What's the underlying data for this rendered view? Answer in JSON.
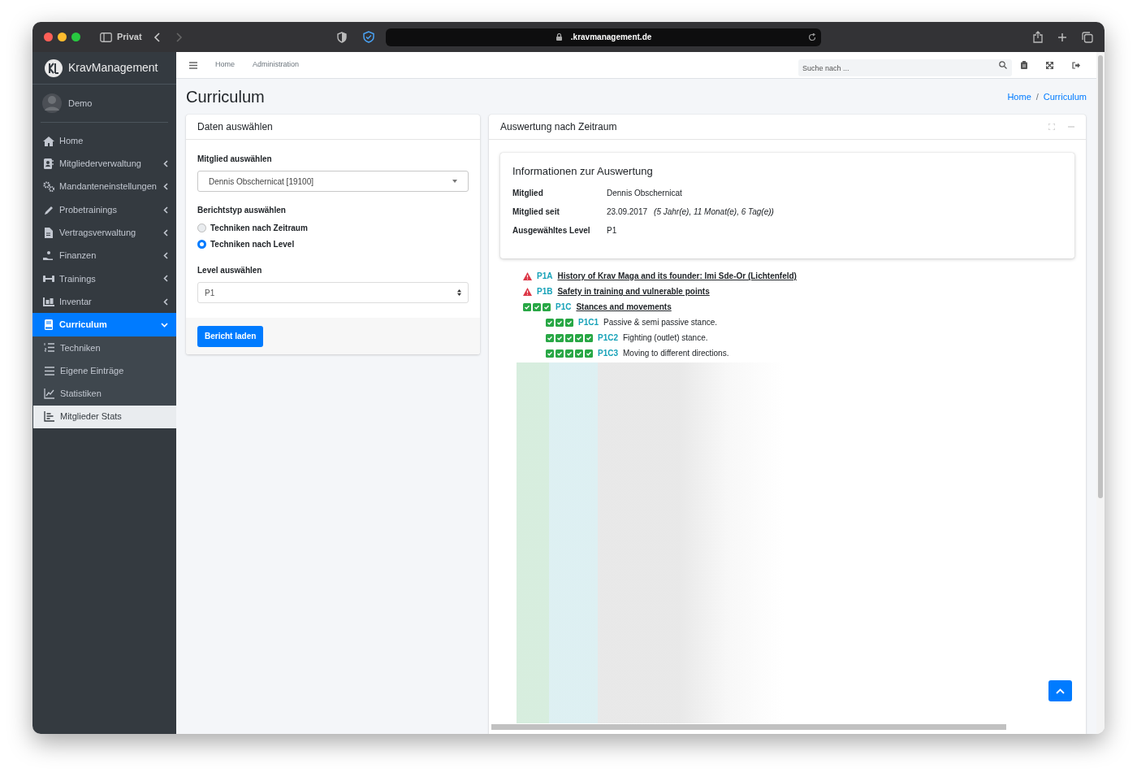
{
  "browser": {
    "profile": "Privat",
    "url": ".kravmanagement.de"
  },
  "sidebar": {
    "brand": "KravManagement",
    "user": "Demo",
    "items": [
      {
        "label": "Home",
        "selected": false
      },
      {
        "label": "Mitgliederverwaltung",
        "selected": false,
        "expanded": false
      },
      {
        "label": "Mandanteneinstellungen",
        "selected": false,
        "expanded": false
      },
      {
        "label": "Probetrainings",
        "selected": false,
        "expanded": false
      },
      {
        "label": "Vertragsverwaltung",
        "selected": false,
        "expanded": false
      },
      {
        "label": "Finanzen",
        "selected": false,
        "expanded": false
      },
      {
        "label": "Trainings",
        "selected": false,
        "expanded": false
      },
      {
        "label": "Inventar",
        "selected": false,
        "expanded": false
      },
      {
        "label": "Curriculum",
        "selected": true,
        "expanded": true,
        "children": [
          {
            "label": "Techniken",
            "selected": false
          },
          {
            "label": "Eigene Einträge",
            "selected": false
          },
          {
            "label": "Statistiken",
            "selected": false
          },
          {
            "label": "Mitglieder Stats",
            "selected": true
          }
        ]
      }
    ]
  },
  "navbar": {
    "links": [
      "Home",
      "Administration"
    ],
    "search": {
      "placeholder": "Suche nach ..."
    }
  },
  "page": {
    "title": "Curriculum",
    "breadcrumb": [
      "Home",
      "Curriculum"
    ],
    "breadcrumb_separator": "/"
  },
  "select_card": {
    "title": "Daten auswählen",
    "member_label": "Mitglied auswählen",
    "member_value": "Dennis Obschernicat [19100]",
    "report_label": "Berichtstyp auswählen",
    "report_types": [
      {
        "label": "Techniken nach Zeitraum",
        "selected": false
      },
      {
        "label": "Techniken nach Level",
        "selected": true
      }
    ],
    "level_label": "Level auswählen",
    "level_value": "P1",
    "button": "Bericht laden"
  },
  "result_card": {
    "title": "Auswertung nach Zeitraum",
    "info": {
      "title": "Informationen zur Auswertung",
      "rows": [
        {
          "label": "Mitglied",
          "value": "Dennis Obschernicat"
        },
        {
          "label": "Mitglied seit",
          "value": "23.09.2017",
          "note": "(5 Jahr(e), 11 Monat(e), 6 Tag(e))"
        },
        {
          "label": "Ausgewähltes Level",
          "value": "P1"
        }
      ]
    },
    "techniques": [
      {
        "code": "P1A",
        "title": "History of Krav Maga and its founder: Imi Sde-Or (Lichtenfeld)",
        "kind": "warning"
      },
      {
        "code": "P1B",
        "title": "Safety in training and vulnerable points",
        "kind": "warning"
      },
      {
        "code": "P1C",
        "title": "Stances and movements",
        "kind": "done",
        "checks": [
          true,
          true,
          true
        ],
        "children": [
          {
            "code": "P1C1",
            "title": "Passive & semi passive stance.",
            "kind": "done",
            "checks": [
              true,
              true,
              true
            ]
          },
          {
            "code": "P1C2",
            "title": "Fighting (outlet) stance.",
            "kind": "done",
            "checks": [
              true,
              true,
              true,
              true,
              true
            ]
          },
          {
            "code": "P1C3",
            "title": "Moving to different directions.",
            "kind": "done",
            "checks": [
              true,
              true,
              true,
              true,
              true
            ]
          }
        ]
      }
    ]
  }
}
